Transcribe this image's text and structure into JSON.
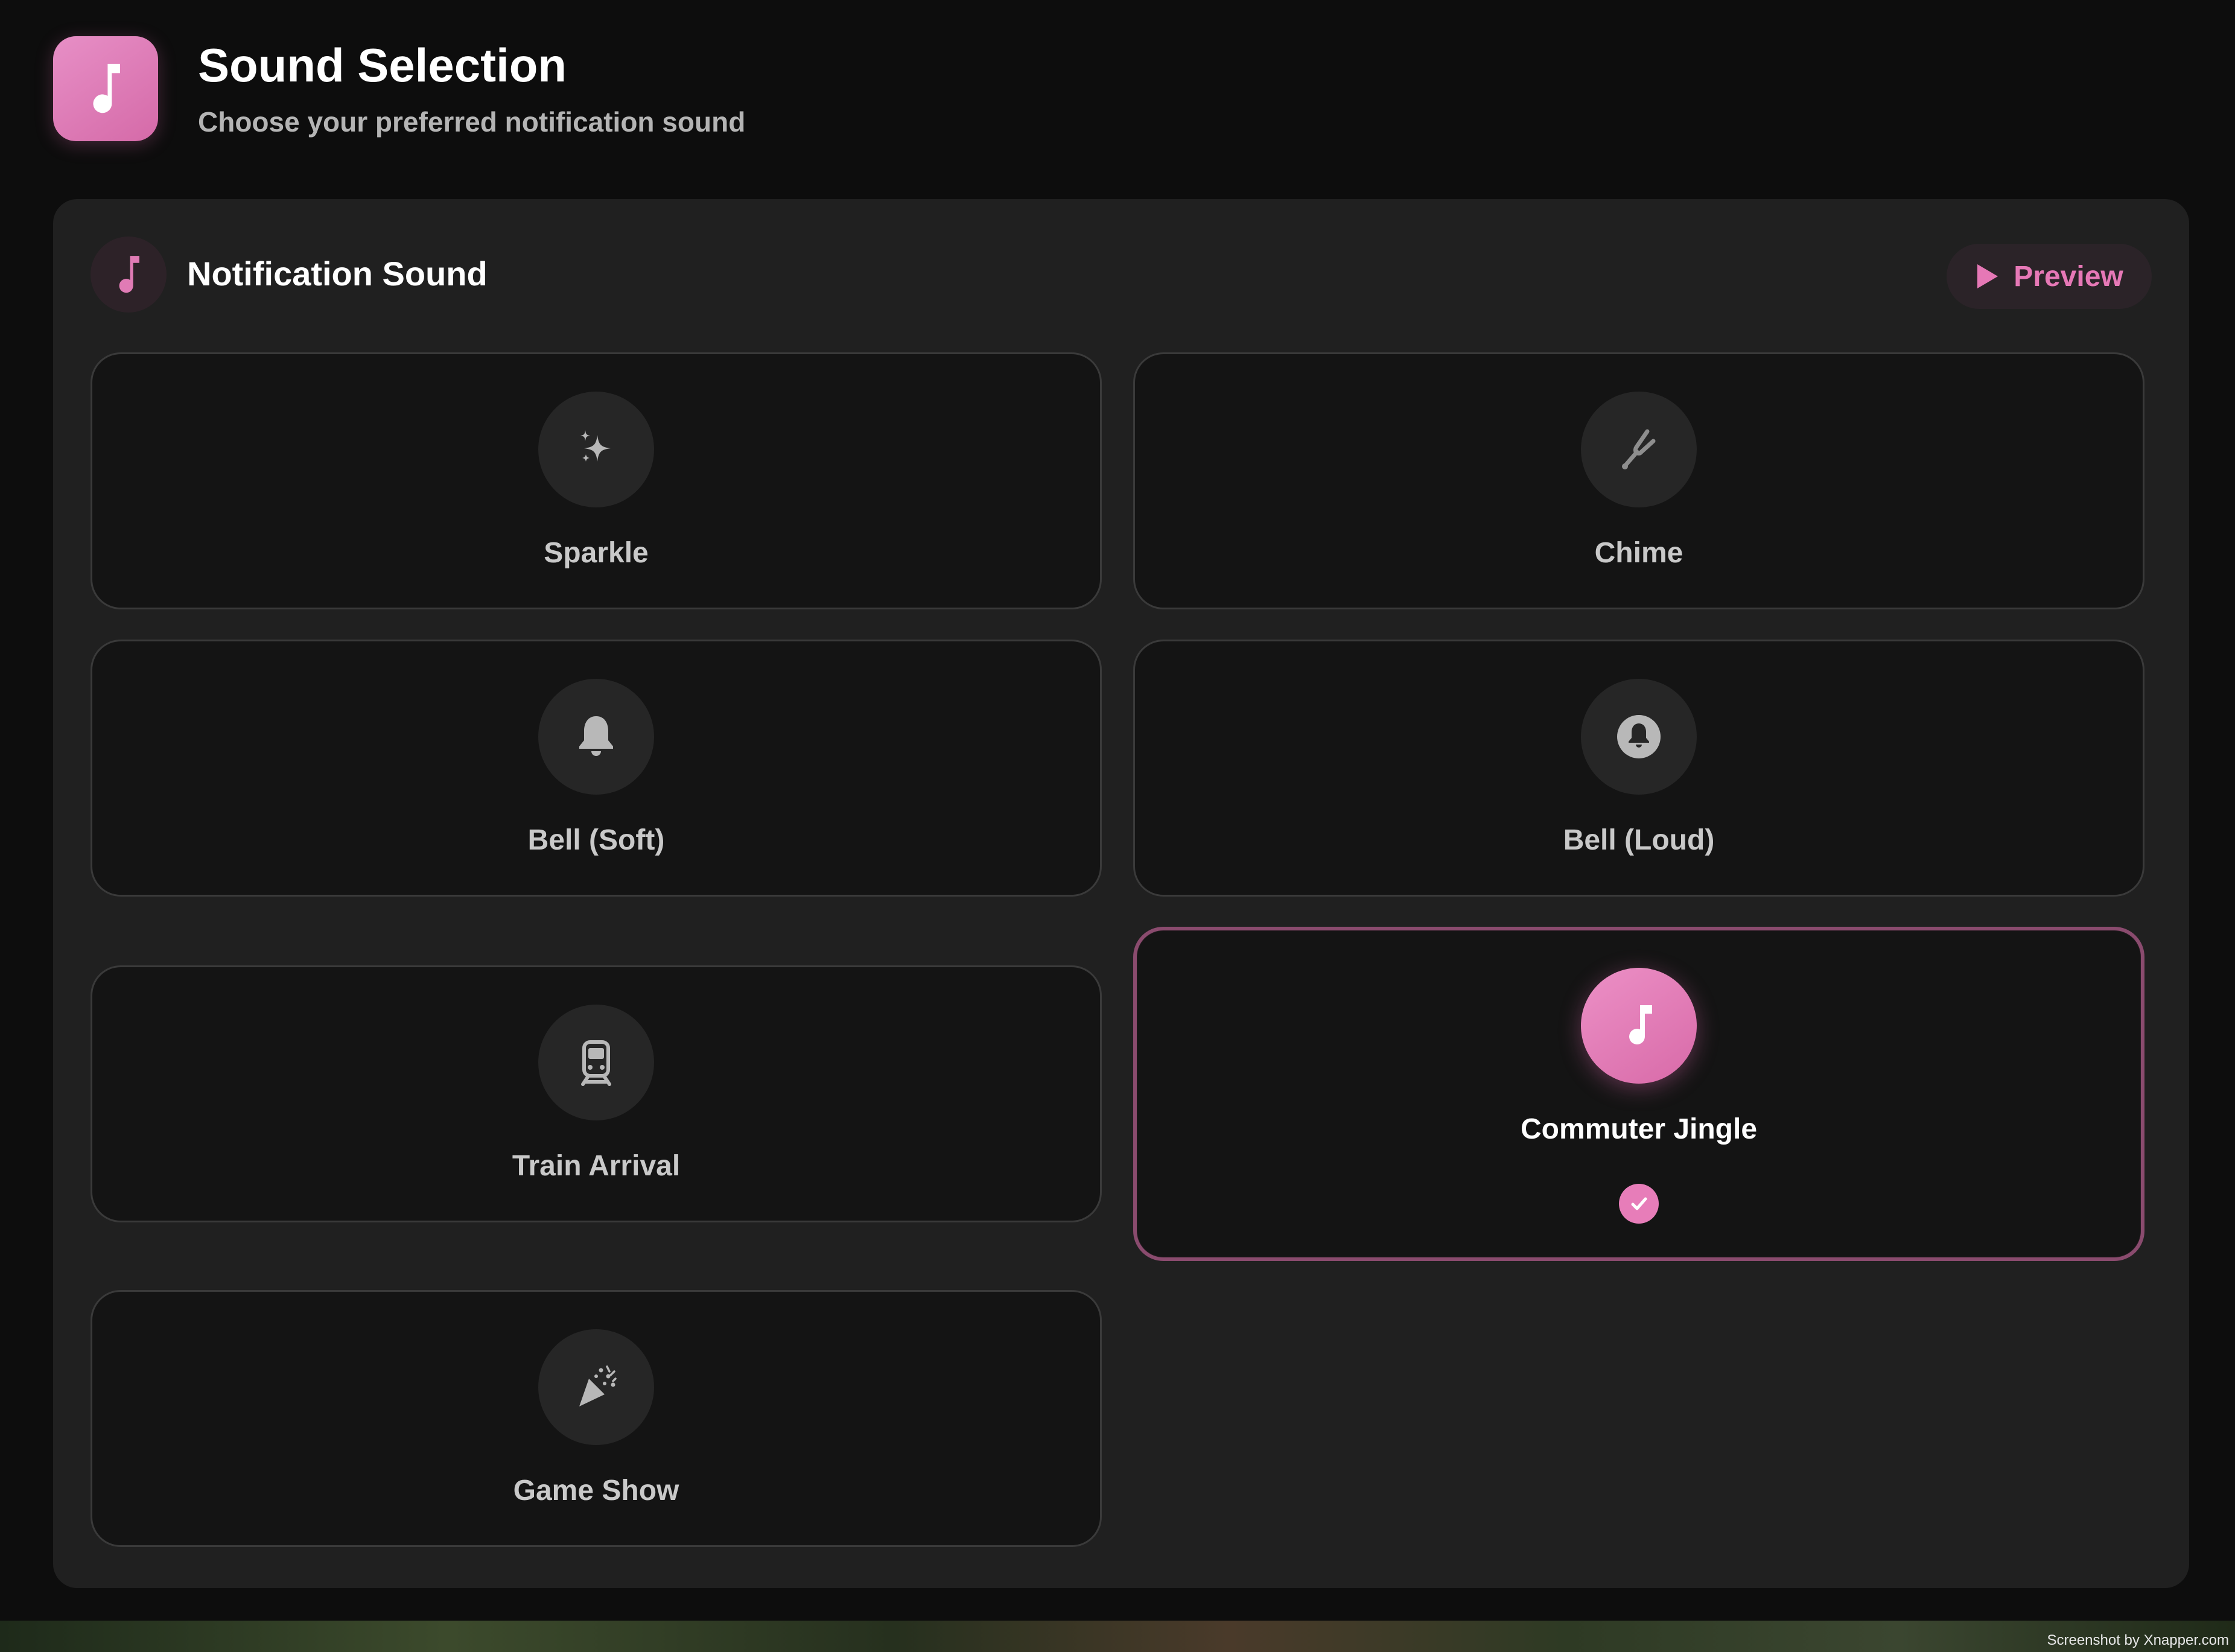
{
  "header": {
    "title": "Sound Selection",
    "subtitle": "Choose your preferred notification sound",
    "icon": "music-note-icon",
    "accent_color": "#e06fb0"
  },
  "panel": {
    "title": "Notification Sound",
    "icon": "music-note-icon",
    "preview_label": "Preview"
  },
  "sounds": [
    {
      "label": "Sparkle",
      "icon": "sparkle-icon",
      "selected": false
    },
    {
      "label": "Chime",
      "icon": "tuning-fork-icon",
      "selected": false
    },
    {
      "label": "Bell (Soft)",
      "icon": "bell-icon",
      "selected": false
    },
    {
      "label": "Bell (Loud)",
      "icon": "bell-circle-icon",
      "selected": false
    },
    {
      "label": "Train Arrival",
      "icon": "train-icon",
      "selected": false
    },
    {
      "label": "Commuter Jingle",
      "icon": "music-note-icon",
      "selected": true
    },
    {
      "label": "Game Show",
      "icon": "party-popper-icon",
      "selected": false
    }
  ],
  "watermark": "Screenshot by Xnapper.com"
}
